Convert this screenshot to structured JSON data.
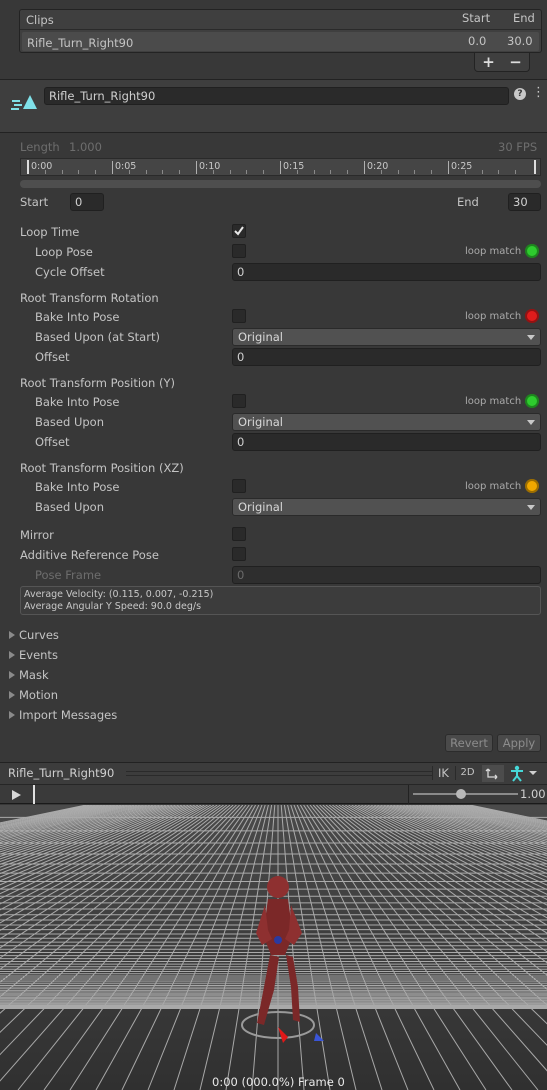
{
  "clips": {
    "header": {
      "label": "Clips",
      "start": "Start",
      "end": "End"
    },
    "rows": [
      {
        "name": "Rifle_Turn_Right90",
        "start": "0.0",
        "end": "30.0"
      }
    ],
    "add": "+",
    "remove": "−"
  },
  "clip_header": {
    "name": "Rifle_Turn_Right90",
    "help": "?",
    "menu": "⋮"
  },
  "timeline": {
    "length_label": "Length",
    "length_value": "1.000",
    "fps": "30 FPS",
    "ticks": [
      "0:00",
      "0:05",
      "0:10",
      "0:15",
      "0:20",
      "0:25"
    ],
    "start_label": "Start",
    "start_value": "0",
    "end_label": "End",
    "end_value": "30"
  },
  "loop": {
    "loop_time": "Loop Time",
    "loop_time_checked": true,
    "loop_pose": "Loop Pose",
    "cycle_offset": "Cycle Offset",
    "cycle_offset_value": "0",
    "loop_match": "loop match",
    "loop_pose_status": "#2ecc2e"
  },
  "rot": {
    "title": "Root Transform Rotation",
    "bake": "Bake Into Pose",
    "based": "Based Upon (at Start)",
    "based_value": "Original",
    "offset": "Offset",
    "offset_value": "0",
    "status": "#e01c1c"
  },
  "posy": {
    "title": "Root Transform Position (Y)",
    "bake": "Bake Into Pose",
    "based": "Based Upon",
    "based_value": "Original",
    "offset": "Offset",
    "offset_value": "0",
    "status": "#2ecc2e"
  },
  "posxz": {
    "title": "Root Transform Position (XZ)",
    "bake": "Bake Into Pose",
    "based": "Based Upon",
    "based_value": "Original",
    "status": "#f0a800"
  },
  "misc": {
    "mirror": "Mirror",
    "additive": "Additive Reference Pose",
    "pose_frame": "Pose Frame",
    "pose_frame_value": "0"
  },
  "info": {
    "velocity": "Average Velocity: (0.115, 0.007, -0.215)",
    "angular": "Average Angular Y Speed: 90.0 deg/s"
  },
  "foldouts": [
    "Curves",
    "Events",
    "Mask",
    "Motion",
    "Import Messages"
  ],
  "buttons": {
    "revert": "Revert",
    "apply": "Apply"
  },
  "preview": {
    "title": "Rifle_Turn_Right90",
    "ik": "IK",
    "two_d": "2D",
    "speed": "1.00",
    "status": "0:00 (000.0%) Frame 0"
  }
}
